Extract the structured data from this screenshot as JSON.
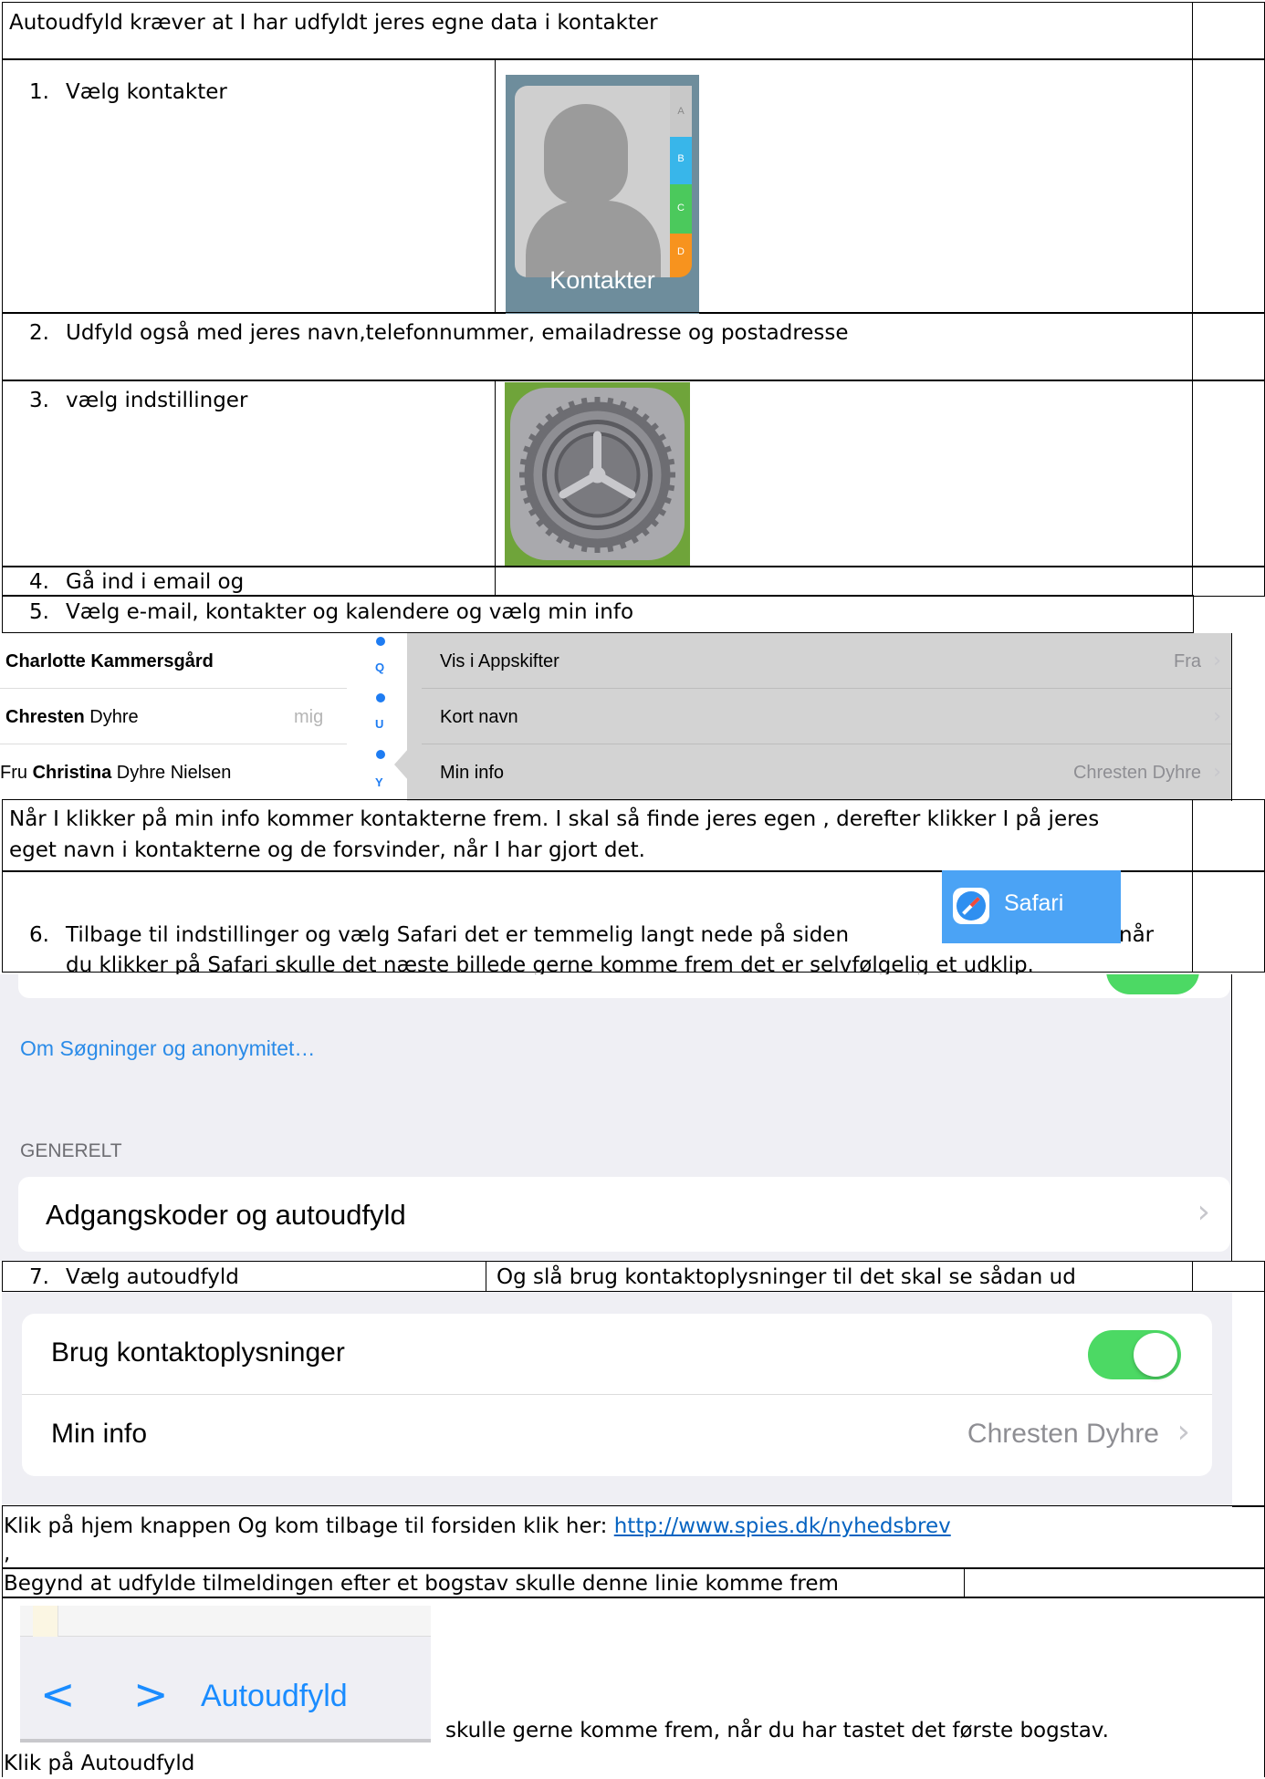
{
  "rows": {
    "intro": "Autoudfyld kræver at I har udfyldt jeres egne data i kontakter",
    "step1": {
      "num": "1.",
      "text": "Vælg kontakter"
    },
    "step2": {
      "num": "2.",
      "text": "Udfyld også med jeres navn,telefonnummer, emailadresse og postadresse"
    },
    "step3": {
      "num": "3.",
      "text": "vælg indstillinger"
    },
    "step4": {
      "num": "4.",
      "text": "Gå ind i email og"
    },
    "step5": {
      "num": "5.",
      "text": "Vælg e-mail, kontakter og kalendere  og vælg min info"
    },
    "note_line1": "Når I klikker på min info kommer kontakterne frem.  I skal så finde jeres egen , derefter klikker I på jeres",
    "note_line2": "eget navn i kontakterne og de forsvinder, når I har gjort det.",
    "step6": {
      "num": "6.",
      "line1": "Tilbage til indstillinger og vælg Safari det er temmelig langt nede på siden",
      "line1_end": "når",
      "line2": "du klikker på Safari skulle det næste billede gerne komme frem det er selvfølgelig et udklip."
    },
    "step7": {
      "num": "7.",
      "text": "Vælg autoudfyld",
      "right": "Og slå brug kontaktoplysninger til det skal se sådan ud"
    },
    "home": {
      "text": "Klik på hjem knappen Og kom tilbage til forsiden klik her: ",
      "link": "http://www.spies.dk/nyhedsbrev",
      "comma": ","
    },
    "begin": "Begynd at udfylde tilmeldingen efter et bogstav skulle denne linie komme frem",
    "after_bar": "skulle gerne komme frem, når du har tastet det første bogstav.",
    "final": "Klik på Autoudfyld"
  },
  "contacts_icon": {
    "label": "Kontakter",
    "tabs": [
      "A",
      "B",
      "C",
      "D"
    ],
    "tab_colors": [
      "#c8c8c8",
      "#38b6ea",
      "#4bc95c",
      "#f7931e"
    ]
  },
  "settings_icon": {
    "name": "gear-icon"
  },
  "shot5": {
    "contacts": [
      {
        "first": "Charlotte Kammersgård",
        "rest": "",
        "badge": ""
      },
      {
        "first": "Chresten",
        "rest": " Dyhre",
        "badge": "mig"
      },
      {
        "first": "Christina",
        "pre": "Fru ",
        "rest": " Dyhre Nielsen",
        "badge": ""
      }
    ],
    "index": [
      "Q",
      "U",
      "Y"
    ],
    "settings": [
      {
        "label": "Vis i Appskifter",
        "value": "Fra"
      },
      {
        "label": "Kort navn",
        "value": ""
      },
      {
        "label": "Min info",
        "value": "Chresten Dyhre"
      }
    ]
  },
  "safari_button": {
    "label": "Safari"
  },
  "shot6": {
    "link": "Om Søgninger og anonymitet…",
    "section": "GENERELT",
    "row": "Adgangskoder og autoudfyld"
  },
  "shot7": {
    "row1": "Brug kontaktoplysninger",
    "row2": "Min info",
    "row2_value": "Chresten Dyhre"
  },
  "shot8": {
    "label": "Autoudfyld"
  }
}
